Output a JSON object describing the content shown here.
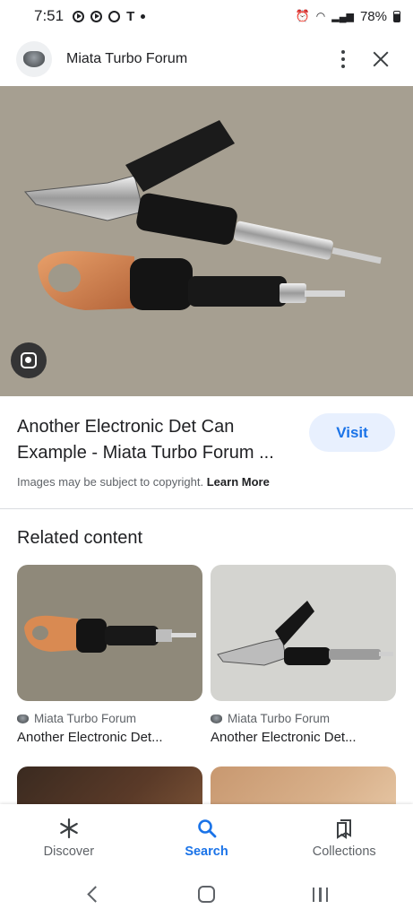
{
  "status_bar": {
    "time": "7:51",
    "carrier_icon": "T",
    "battery": "78%"
  },
  "header": {
    "site_name": "Miata Turbo Forum",
    "logo_icon": "forum-logo-icon",
    "more_icon": "more-vert-icon",
    "close_icon": "close-icon"
  },
  "result": {
    "title": "Another Electronic Det Can Example - Miata Turbo Forum ...",
    "visit_label": "Visit",
    "copyright_text": "Images may be subject to copyright.",
    "learn_more_label": "Learn More"
  },
  "related": {
    "heading": "Related content",
    "cards": [
      {
        "source": "Miata Turbo Forum",
        "title": "Another Electronic Det..."
      },
      {
        "source": "Miata Turbo Forum",
        "title": "Another Electronic Det..."
      }
    ]
  },
  "bottom_nav": {
    "items": [
      {
        "label": "Discover",
        "icon": "asterisk-icon"
      },
      {
        "label": "Search",
        "icon": "search-icon",
        "active": true
      },
      {
        "label": "Collections",
        "icon": "collections-icon"
      }
    ]
  },
  "colors": {
    "accent": "#1a73e8",
    "visit_bg": "#e8f0fe"
  }
}
